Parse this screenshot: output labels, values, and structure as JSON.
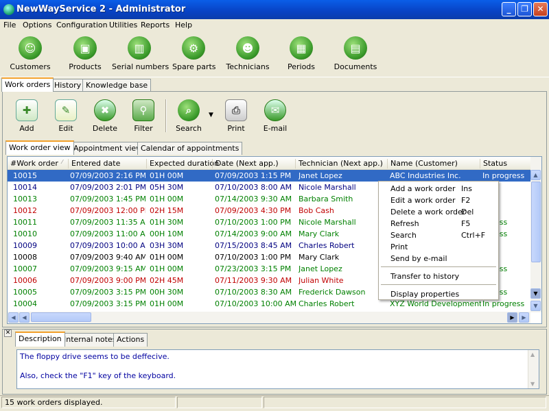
{
  "window": {
    "title": "NewWayService 2 - Administrator"
  },
  "menu": [
    "File",
    "Options",
    "Configuration",
    "Utilities",
    "Reports",
    "Help"
  ],
  "top_toolbar": [
    {
      "label": "Customers",
      "icon": "customers-icon",
      "color": "#3a9a2a"
    },
    {
      "label": "Products",
      "icon": "products-icon",
      "color": "#3a9a2a"
    },
    {
      "label": "Serial numbers",
      "icon": "barcode-icon",
      "color": "#3a9a2a"
    },
    {
      "label": "Spare parts",
      "icon": "spare-parts-icon",
      "color": "#3a9a2a"
    },
    {
      "label": "Technicians",
      "icon": "technicians-icon",
      "color": "#3a9a2a"
    },
    {
      "label": "Periods",
      "icon": "periods-icon",
      "color": "#3a9a2a"
    },
    {
      "label": "Documents",
      "icon": "documents-icon",
      "color": "#3a9a2a"
    }
  ],
  "main_tabs": [
    "Work orders",
    "History",
    "Knowledge base"
  ],
  "action_toolbar": [
    {
      "label": "Add",
      "icon": "add-icon"
    },
    {
      "label": "Edit",
      "icon": "edit-icon"
    },
    {
      "label": "Delete",
      "icon": "delete-icon"
    },
    {
      "label": "Filter",
      "icon": "filter-icon"
    },
    {
      "label": "Search",
      "icon": "search-icon"
    },
    {
      "label": "Print",
      "icon": "print-icon"
    },
    {
      "label": "E-mail",
      "icon": "email-icon"
    }
  ],
  "view_tabs": [
    "Work order view",
    "Appointment view",
    "Calendar of appointments"
  ],
  "columns": [
    "#Work order",
    "Entered date",
    "Expected duration",
    "Date (Next app.)",
    "Technician (Next app.)",
    "Name (Customer)",
    "Status"
  ],
  "rows": [
    {
      "id": "10015",
      "entered": "07/09/2003 2:16 PM",
      "duration": "01H 00M",
      "next": "07/09/2003 1:15 PM",
      "tech": "Janet Lopez",
      "customer": "ABC Industries Inc.",
      "status": "In progress",
      "color": "#ffffff",
      "selected": true
    },
    {
      "id": "10014",
      "entered": "07/09/2003 2:01 PM",
      "duration": "05H 30M",
      "next": "07/10/2003 8:00 AM",
      "tech": "Nicole Marshall",
      "customer": "",
      "status": "ned",
      "color": "#000080"
    },
    {
      "id": "10013",
      "entered": "07/09/2003 1:45 PM",
      "duration": "01H 00M",
      "next": "07/14/2003 9:30 AM",
      "tech": "Barbara Smith",
      "customer": "",
      "status": "",
      "color": "#008000"
    },
    {
      "id": "10012",
      "entered": "07/09/2003 12:00 PM",
      "duration": "02H 15M",
      "next": "07/09/2003 4:30 PM",
      "tech": "Bob Cash",
      "customer": "",
      "status": "l",
      "color": "#c00000"
    },
    {
      "id": "10011",
      "entered": "07/09/2003 11:35 AM",
      "duration": "01H 30M",
      "next": "07/10/2003 1:00 PM",
      "tech": "Nicole Marshall",
      "customer": "",
      "status": "ogress",
      "color": "#008000"
    },
    {
      "id": "10010",
      "entered": "07/09/2003 11:00 AM",
      "duration": "00H 10M",
      "next": "07/14/2003 9:00 AM",
      "tech": "Mary Clark",
      "customer": "",
      "status": "ogress",
      "color": "#008000"
    },
    {
      "id": "10009",
      "entered": "07/09/2003 10:00 AM",
      "duration": "03H 30M",
      "next": "07/15/2003 8:45 AM",
      "tech": "Charles Robert",
      "customer": "",
      "status": "ned",
      "color": "#000080"
    },
    {
      "id": "10008",
      "entered": "07/09/2003 9:40 AM",
      "duration": "01H 00M",
      "next": "07/10/2003 1:00 PM",
      "tech": "Mary Clark",
      "customer": "",
      "status": "",
      "color": "#000000"
    },
    {
      "id": "10007",
      "entered": "07/09/2003 9:15 AM",
      "duration": "01H 00M",
      "next": "07/23/2003 3:15 PM",
      "tech": "Janet Lopez",
      "customer": "",
      "status": "ogress",
      "color": "#008000"
    },
    {
      "id": "10006",
      "entered": "07/09/2003 9:00 PM",
      "duration": "02H 45M",
      "next": "07/11/2003 9:30 AM",
      "tech": "Julian White",
      "customer": "",
      "status": "l",
      "color": "#c00000"
    },
    {
      "id": "10005",
      "entered": "07/09/2003 3:15 PM",
      "duration": "00H 30M",
      "next": "07/10/2003 8:30 AM",
      "tech": "Frederick Dawson",
      "customer": "",
      "status": "ogress",
      "color": "#008000"
    },
    {
      "id": "10004",
      "entered": "07/09/2003 3:15 PM",
      "duration": "01H 00M",
      "next": "07/10/2003 10:00 AM",
      "tech": "Charles Robert",
      "customer": "XYZ World Development ...",
      "status": "In progress",
      "color": "#008000"
    }
  ],
  "context_menu": [
    {
      "label": "Add a work order",
      "shortcut": "Ins"
    },
    {
      "label": "Edit a work order",
      "shortcut": "F2"
    },
    {
      "label": "Delete a work order",
      "shortcut": "Del"
    },
    {
      "label": "Refresh",
      "shortcut": "F5"
    },
    {
      "label": "Search",
      "shortcut": "Ctrl+F"
    },
    {
      "label": "Print",
      "shortcut": ""
    },
    {
      "label": "Send by e-mail",
      "shortcut": ""
    },
    {
      "label": "Transfer to history",
      "shortcut": ""
    },
    {
      "label": "Display properties",
      "shortcut": ""
    }
  ],
  "bottom_tabs": [
    "Description",
    "Internal notes",
    "Actions"
  ],
  "description": {
    "line1": "The floppy drive seems to be deffecive.",
    "line2": "Also, check the \"F1\" key of the keyboard."
  },
  "status_bar": {
    "text": "15 work orders displayed."
  }
}
